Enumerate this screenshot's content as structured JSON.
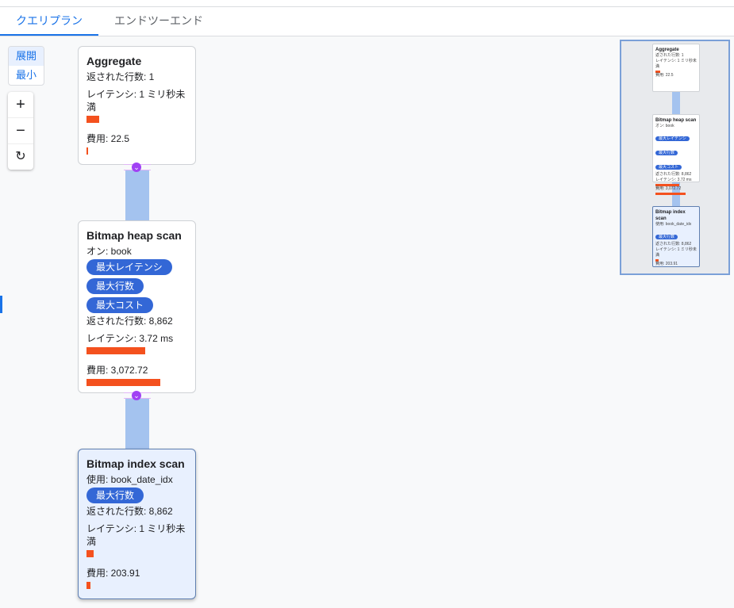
{
  "tabs": [
    {
      "label": "クエリプラン",
      "active": true
    },
    {
      "label": "エンドツーエンド",
      "active": false
    }
  ],
  "view_toggle": {
    "expand": "展開",
    "minimize": "最小"
  },
  "zoom": {
    "in": "+",
    "out": "−",
    "reset": "↻"
  },
  "nodes": [
    {
      "title": "Aggregate",
      "rows": "返された行数: 1",
      "latency": "レイテンシ: 1 ミリ秒未満",
      "cost": "費用: 22.5",
      "latency_fraction": 0.04,
      "cost_fraction": 0.006
    },
    {
      "title": "Bitmap heap scan",
      "on": "オン: book",
      "badges": [
        "最大レイテンシ",
        "最大行数",
        "最大コスト"
      ],
      "rows": "返された行数: 8,862",
      "latency": "レイテンシ: 3.72 ms",
      "cost": "費用: 3,072.72",
      "latency_fraction": 0.58,
      "cost_fraction": 0.72
    },
    {
      "title": "Bitmap index scan",
      "using": "使用: book_date_idx",
      "badges": [
        "最大行数"
      ],
      "rows": "返された行数: 8,862",
      "latency": "レイテンシ: 1 ミリ秒未満",
      "cost": "費用: 203.91",
      "latency_fraction": 0.04,
      "cost_fraction": 0.03
    }
  ],
  "expander_icon": "chevron-down",
  "colors": {
    "accent": "#1a73e8",
    "badge": "#3367d6",
    "bar": "#f4511e",
    "connector": "#a4c3ef",
    "expander": "#a142f4"
  }
}
